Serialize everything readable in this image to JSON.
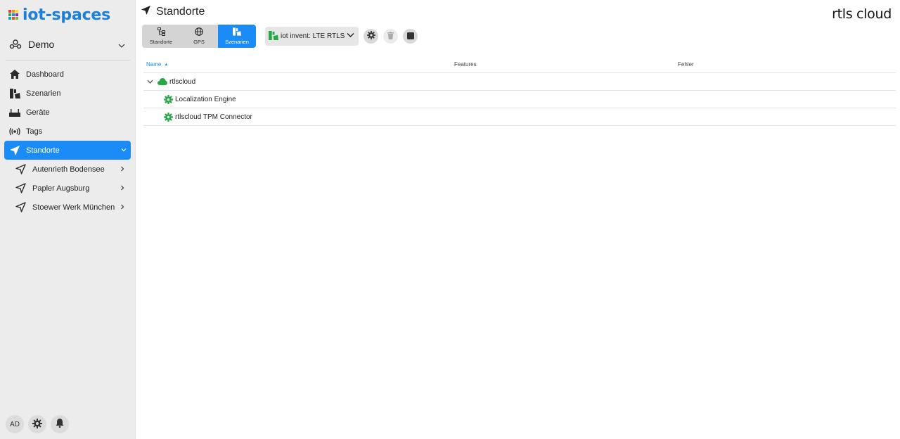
{
  "brand": {
    "name": "iot-spaces",
    "grid_colors": [
      "#e53935",
      "#fb8c00",
      "#fdd835",
      "#43a047",
      "#1e88e5",
      "#8e24aa",
      "#00acc1",
      "#f4511e",
      "#7cb342"
    ]
  },
  "tenant": {
    "name": "Demo"
  },
  "nav": {
    "items": [
      {
        "label": "Dashboard",
        "icon": "home-icon"
      },
      {
        "label": "Szenarien",
        "icon": "scenarios-icon"
      },
      {
        "label": "Geräte",
        "icon": "devices-icon"
      },
      {
        "label": "Tags",
        "icon": "tags-icon"
      },
      {
        "label": "Standorte",
        "icon": "location-arrow-icon",
        "active": true
      }
    ],
    "subitems": [
      {
        "label": "Autenrieth Bodensee"
      },
      {
        "label": "Papler Augsburg"
      },
      {
        "label": "Stoewer Werk München"
      }
    ]
  },
  "footer": {
    "avatar": "AD"
  },
  "header": {
    "title": "Standorte",
    "logo": "rtls cloud"
  },
  "toolbar": {
    "segments": [
      {
        "label": "Standorte",
        "icon": "hierarchy-icon"
      },
      {
        "label": "GPS",
        "icon": "globe-icon"
      },
      {
        "label": "Szenarien",
        "icon": "scenarios-icon",
        "selected": true
      }
    ],
    "dropdown": "iot invent: LTE RTLS"
  },
  "table": {
    "columns": [
      "Name",
      "Features",
      "Fehler"
    ],
    "sort_indicator": "▲",
    "rows": [
      {
        "name": "rtlscloud",
        "level": 0,
        "icon": "cloud-icon",
        "expanded": true
      },
      {
        "name": "Localization Engine",
        "level": 1,
        "icon": "gear-icon"
      },
      {
        "name": "rtlscloud TPM Connector",
        "level": 1,
        "icon": "gear-icon"
      }
    ]
  },
  "colors": {
    "accent": "#1b8bf5",
    "green": "#27a745",
    "sidebar_bg": "#ececec"
  }
}
